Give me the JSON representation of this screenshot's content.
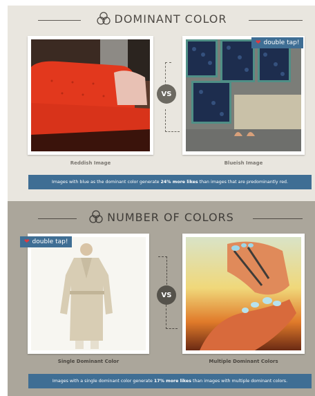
{
  "colors": {
    "section1_bg": "#e9e6df",
    "section2_bg": "#aba69b",
    "banner": "#3f6e94",
    "vs_badge": "#6c6961",
    "heart": "#e0393f"
  },
  "section1": {
    "title": "DOMINANT COLOR",
    "title_icon": "flower-petal-icon",
    "left_caption": "Reddish Image",
    "right_caption": "Blueish Image",
    "vs_label": "VS",
    "tap_label": "double tap!",
    "banner": {
      "before": "Images with blue as the dominant color generate ",
      "emphasis": "24% more likes",
      "after": " than images that are predominantly red."
    }
  },
  "section2": {
    "title": "NUMBER OF COLORS",
    "title_icon": "flower-petal-icon",
    "left_caption": "Single Dominant Color",
    "right_caption": "Multiple Dominant Colors",
    "vs_label": "VS",
    "tap_label": "double tap!",
    "banner": {
      "before": "Images with a single dominant color generate ",
      "emphasis": "17% more likes",
      "after": " than images with multiple dominant colors."
    }
  }
}
